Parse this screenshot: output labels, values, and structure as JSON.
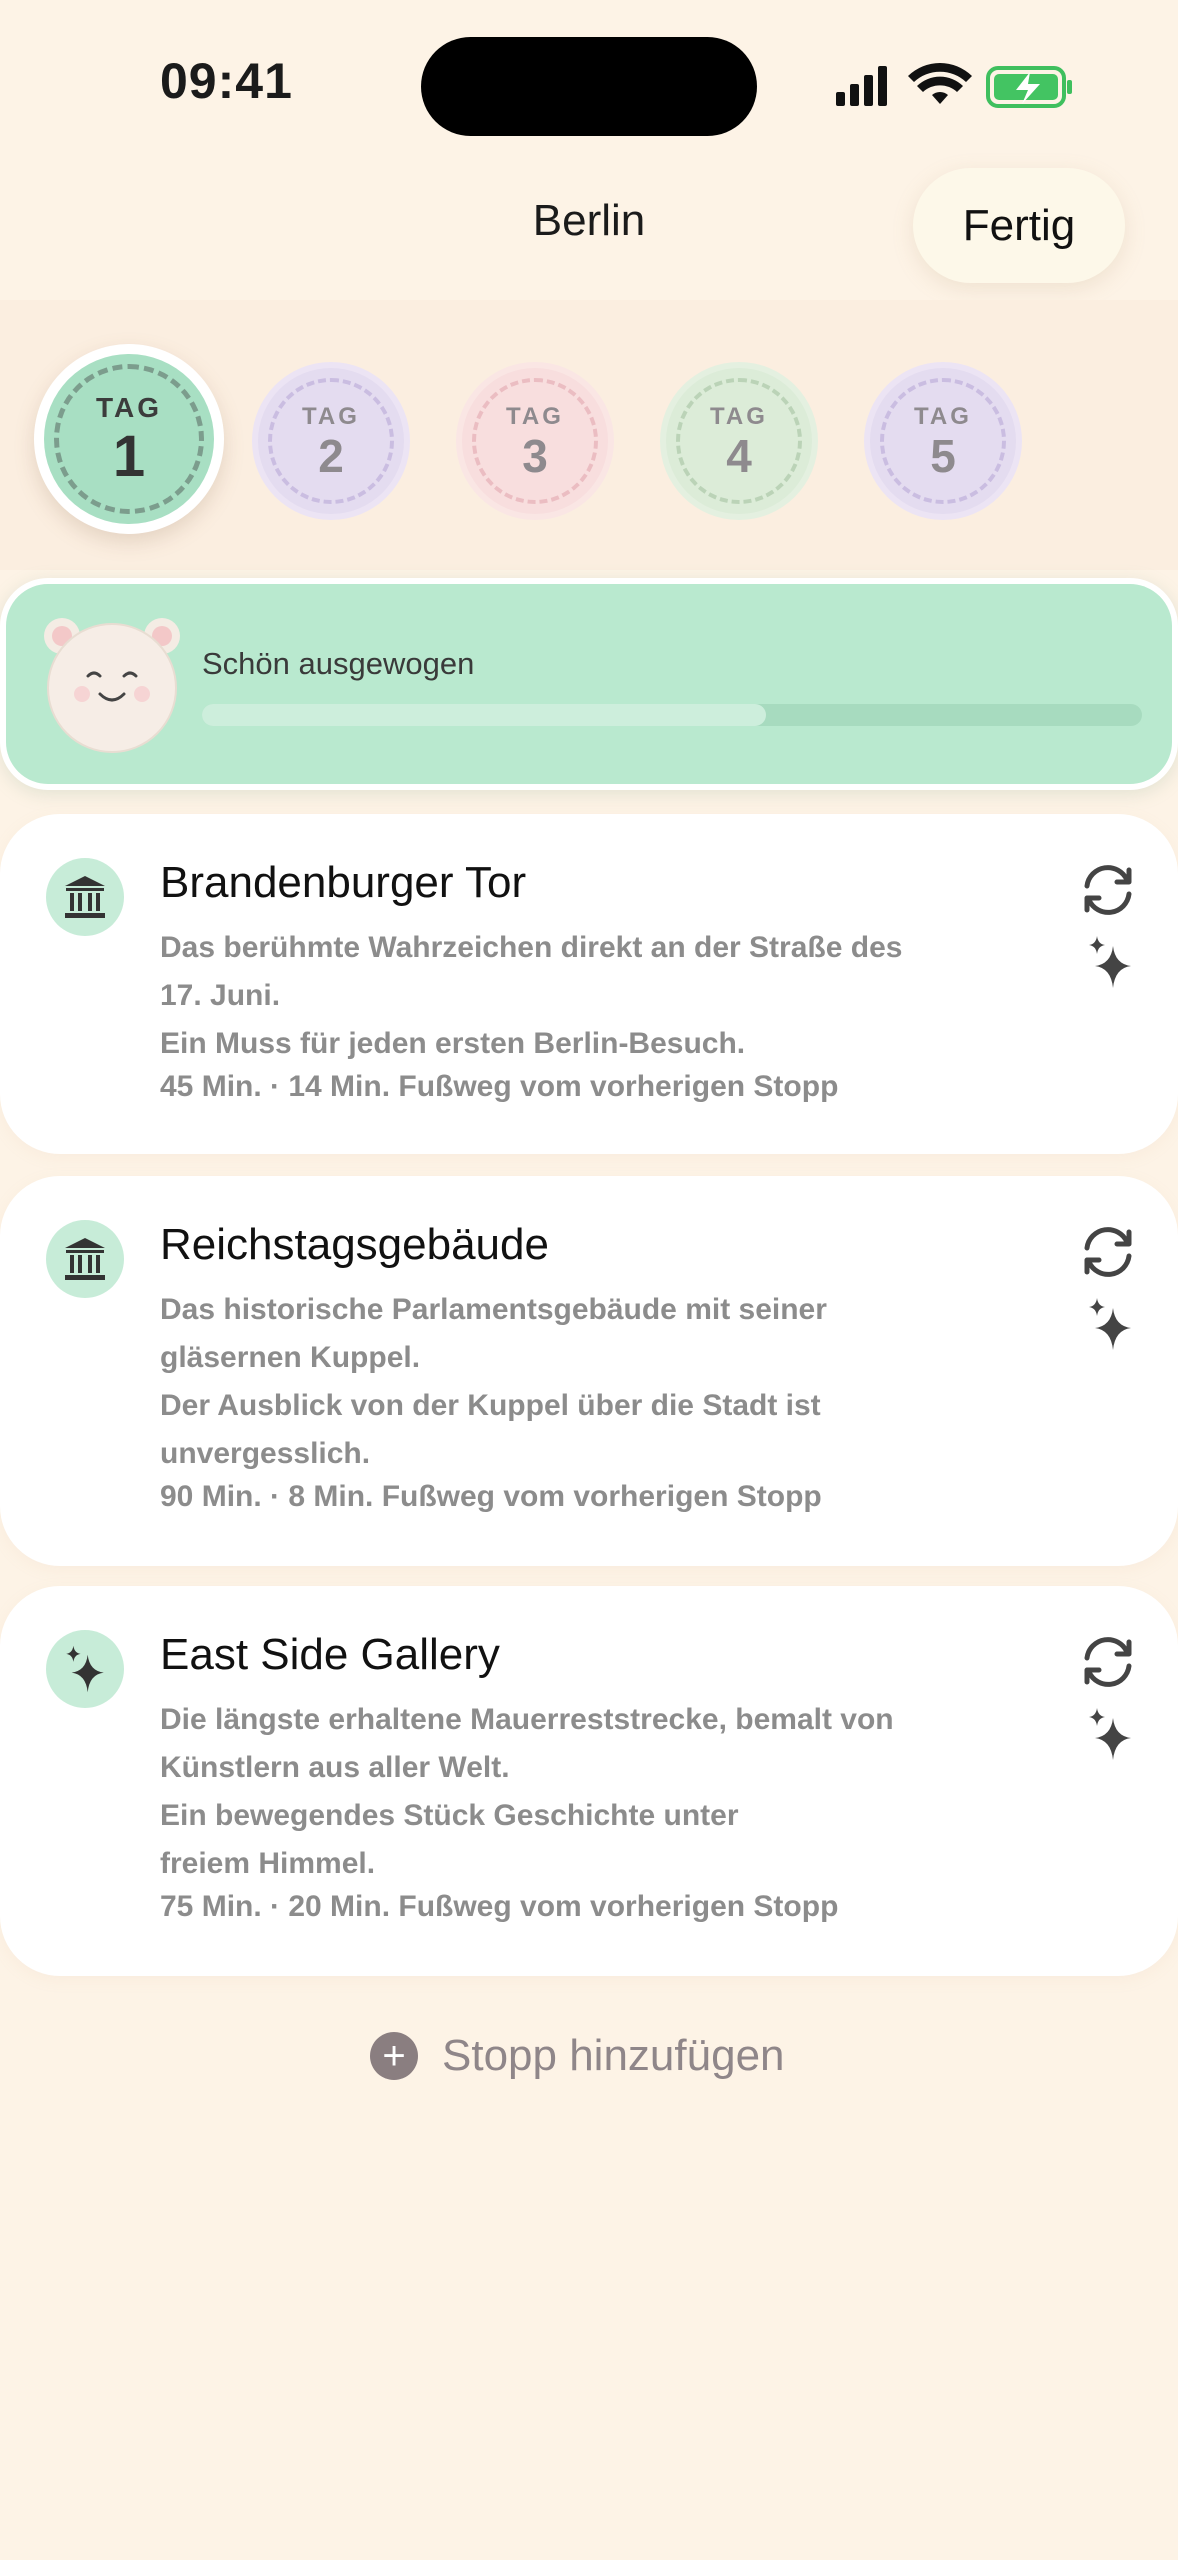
{
  "status_bar": {
    "time": "09:41"
  },
  "header": {
    "title": "Berlin",
    "done_label": "Fertig"
  },
  "days": [
    {
      "label": "TAG",
      "number": "1",
      "active": true,
      "color": "#a8dfc3"
    },
    {
      "label": "TAG",
      "number": "2",
      "active": false,
      "color": "#e4dcf0"
    },
    {
      "label": "TAG",
      "number": "3",
      "active": false,
      "color": "#f8dede"
    },
    {
      "label": "TAG",
      "number": "4",
      "active": false,
      "color": "#dcecd8"
    },
    {
      "label": "TAG",
      "number": "5",
      "active": false,
      "color": "#e4dcf0"
    }
  ],
  "balance": {
    "label": "Schön ausgewogen",
    "level": 0.6
  },
  "stops": [
    {
      "icon": "museum-icon",
      "title": "Brandenburger Tor",
      "desc1": "Das berühmte Wahrzeichen direkt an der Straße des",
      "desc2": "17. Juni.",
      "desc3": "Ein Muss für jeden ersten Berlin-Besuch.",
      "meta": "45 Min. · 14 Min. Fußweg vom vorherigen Stopp"
    },
    {
      "icon": "museum-icon",
      "title": "Reichstagsgebäude",
      "desc1": "Das historische Parlamentsgebäude mit seiner",
      "desc2": "gläsernen Kuppel.",
      "desc3": "Der Ausblick von der Kuppel über die Stadt ist",
      "desc4": "unvergesslich.",
      "meta": "90 Min. · 8 Min. Fußweg vom vorherigen Stopp"
    },
    {
      "icon": "sparkles-icon",
      "title": "East Side Gallery",
      "desc1": "Die längste erhaltene Mauerreststrecke, bemalt von",
      "desc2": "Künstlern aus aller Welt.",
      "desc3": "Ein bewegendes Stück Geschichte unter",
      "desc4": "freiem Himmel.",
      "meta": "75 Min. · 20 Min. Fußweg vom vorherigen Stopp"
    }
  ],
  "add_stop": {
    "label": "Stopp hinzufügen"
  },
  "colors": {
    "background": "#fdf3e6",
    "accent_green": "#b9e9cf",
    "text_secondary": "#8c8c8c"
  }
}
